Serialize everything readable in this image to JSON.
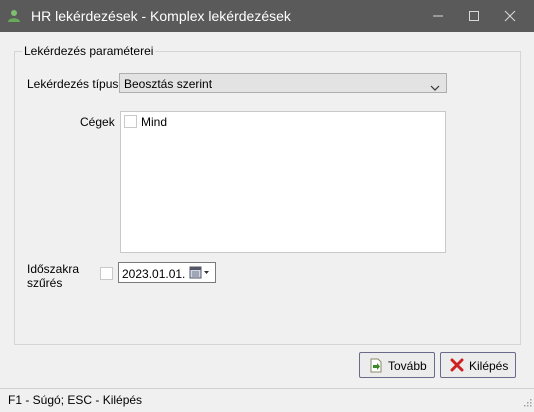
{
  "window": {
    "title": "HR lekérdezések - Komplex lekérdezések"
  },
  "group": {
    "legend": "Lekérdezés paraméterei"
  },
  "query_type": {
    "label": "Lekérdezés típusa",
    "value": "Beosztás szerint"
  },
  "companies": {
    "label": "Cégek",
    "items": [
      {
        "label": "Mind",
        "checked": false
      }
    ]
  },
  "period": {
    "label_line1": "Időszakra",
    "label_line2": "szűrés",
    "checked": false,
    "date": "2023.01.01."
  },
  "buttons": {
    "next": "Tovább",
    "exit": "Kilépés"
  },
  "statusbar": {
    "text": "F1 - Súgó; ESC - Kilépés"
  },
  "colors": {
    "titlebar": "#5a5a5a",
    "exit_icon": "#cc2222",
    "next_icon": "#3a8a2a"
  }
}
